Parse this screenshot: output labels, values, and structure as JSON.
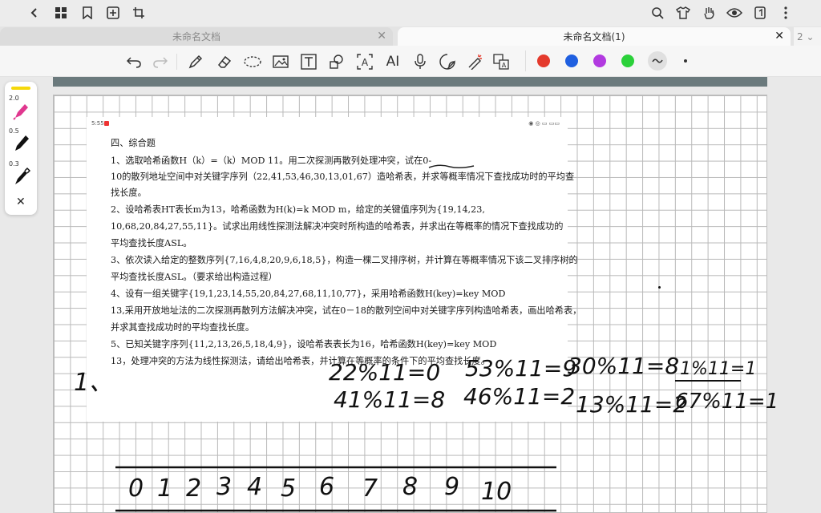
{
  "tabs": [
    {
      "label": "未命名文档",
      "close": "✕"
    },
    {
      "label": "未命名文档(1)",
      "close": "✕"
    }
  ],
  "tab_more": "2 ⌄",
  "topbar": {
    "back_icon": "chevron-left-icon",
    "right_icons": [
      "search-icon",
      "shirt-icon",
      "hand-icon",
      "eye-icon",
      "tablet-icon",
      "more-vertical-icon"
    ]
  },
  "toolbar": {
    "tools": [
      "undo-icon",
      "redo-icon",
      "pen-icon",
      "eraser-icon",
      "lasso-icon",
      "image-icon",
      "text-box-icon",
      "shape-icon",
      "ocr-icon",
      "ai-icon",
      "microphone-icon",
      "sticker-icon",
      "laser-pointer-icon",
      "translate-icon"
    ],
    "ai_label": "AI",
    "colors": [
      "#e43a2c",
      "#1f5fe0",
      "#b23ae0",
      "#2bd13a"
    ]
  },
  "side_panel": {
    "sizes": [
      "2.0",
      "0.5",
      "0.3"
    ],
    "close": "✕"
  },
  "screenshot": {
    "time": "5:55",
    "lines": [
      "四、综合题",
      "1、选取哈希函数H（k）=（k）MOD                                          11。用二次探测再散列处理冲突，试在0-",
      "10的散列地址空间中对关键字序列（22,41,53,46,30,13,01,67）造哈希表，并求等概率情况下查找成功时的平均查",
      "找长度。",
      "2、设哈希表HT表长m为13，哈希函数为H(k)=k               MOD              m，给定的关键值序列为{19,14,23,",
      "10,68,20,84,27,55,11}。试求出用线性探测法解决冲突时所构造的哈希表，并求出在等概率的情况下查找成功的",
      "平均查找长度ASL。",
      "3、依次读入给定的整数序列{7,16,4,8,20,9,6,18,5}，构造一棵二叉排序树，并计算在等概率情况下该二叉排序树的",
      "平均查找长度ASL。（要求给出构造过程）",
      "4、设有一组关键字{19,1,23,14,55,20,84,27,68,11,10,77}，采用哈希函数H(key)=key MOD",
      "13,采用开放地址法的二次探测再散列方法解决冲突，试在0－18的散列空间中对关键字序列构造哈希表，画出哈希表，",
      "并求其查找成功时的平均查找长度。",
      "5、已知关键字序列{11,2,13,26,5,18,4,9}，设哈希表表长为16，哈希函数H(key)=key                          MOD",
      "13，处理冲突的方法为线性探测法，请给出哈希表，并计算在等概率的条件下的平均查找长度。"
    ]
  },
  "handwriting": {
    "label": "1、",
    "eq1": "22%11=0",
    "eq2": "53%11=9",
    "eq3": "30%11=8",
    "eq4": "1%11=1",
    "eq5": "41%11=8",
    "eq6": "46%11=2",
    "eq7": "13%11=2",
    "eq8": "67%11=1",
    "indices": [
      "0",
      "1",
      "2",
      "3",
      "4",
      "5",
      "6",
      "7",
      "8",
      "9",
      "10"
    ]
  }
}
